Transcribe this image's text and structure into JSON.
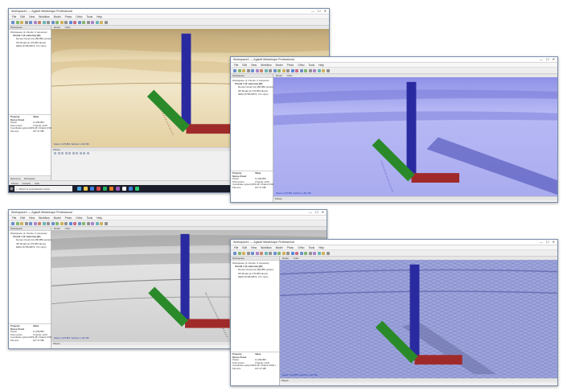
{
  "app": {
    "window_title": "Workspace1 — Agisoft Metashape Professional",
    "menu": [
      "File",
      "Edit",
      "View",
      "Workflow",
      "Model",
      "Photo",
      "Ortho",
      "Tools",
      "Help"
    ],
    "window_controls": [
      "—",
      "☐",
      "✕"
    ]
  },
  "workspace": {
    "panel_title": "Workspace",
    "root": "Workspace (1 chunks, 0 cameras)",
    "chunk": "Chunk 1 (0 cameras) [R]",
    "items": [
      "Dense Cloud (11,186,850 points)",
      "3D Model (2,176,863 faces)",
      "DEM (3725x3872, 0.3 m/px)"
    ]
  },
  "properties": {
    "header": [
      "Property",
      "Value"
    ],
    "title": "Dense Cloud",
    "rows": [
      {
        "k": "Points",
        "v": "11,186,850"
      },
      {
        "k": "Point colors",
        "v": "3 bands, uint8"
      },
      {
        "k": "Coordinate system",
        "v": "CRS-08 / Poland CS92 (..."
      },
      {
        "k": "File size",
        "v": "167.47 MB"
      }
    ]
  },
  "left_tabs": [
    "Reference",
    "Workspace"
  ],
  "viewport": {
    "tabs": [
      "Model",
      "Ortho"
    ],
    "status_label": "Faces: 2,176,863, Vertices: 1,101,790",
    "photos_label": "Photos"
  },
  "bottom_tabs": [
    "Photos",
    "Console",
    "Jobs"
  ],
  "taskbar": {
    "search_placeholder": "Wpisz tu wyszukiwane słowo"
  },
  "render_modes": [
    "solid-textured",
    "solid-shaded-blue",
    "shaded-gray",
    "wireframe"
  ],
  "colors": {
    "accent": "#1a3caa",
    "textured": "#e8d5a8",
    "shaded_blue": "#a7a9f2",
    "shaded_gray": "#d4d4d4",
    "wireframe": "#8f97d2"
  }
}
